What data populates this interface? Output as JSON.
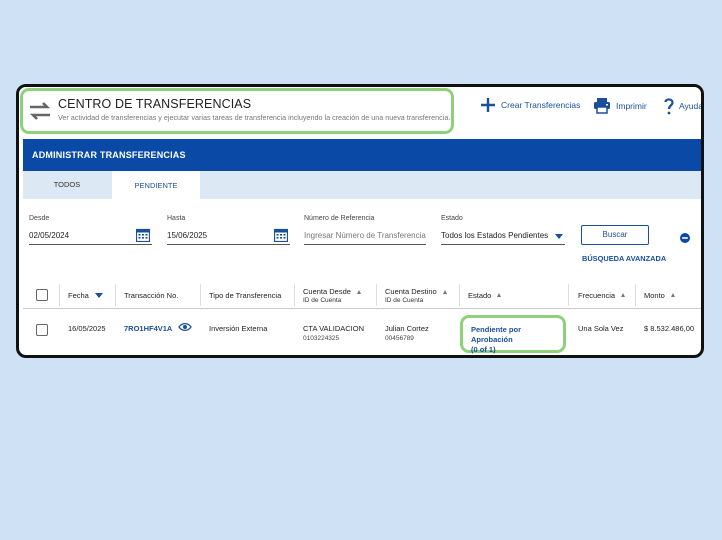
{
  "header": {
    "title": "CENTRO DE TRANSFERENCIAS",
    "subtitle": "Ver actividad de transferencias y ejecutar varias tareas de transferencia incluyendo la creación de una nueva transferencia.",
    "actions": {
      "create": "Crear Transferencias",
      "print": "Imprimir",
      "help": "Ayuda"
    }
  },
  "section": {
    "title": "ADMINISTRAR TRANSFERENCIAS"
  },
  "tabs": [
    {
      "label": "TODOS",
      "active": false
    },
    {
      "label": "PENDIENTE",
      "active": true
    }
  ],
  "filters": {
    "desde": {
      "label": "Desde",
      "value": "02/05/2024"
    },
    "hasta": {
      "label": "Hasta",
      "value": "15/06/2025"
    },
    "referencia": {
      "label": "Número de Referencia",
      "placeholder": "Ingresar Número de Transferencia"
    },
    "estado": {
      "label": "Estado",
      "value": "Todos los Estados Pendientes"
    },
    "search_button": "Buscar",
    "advanced_search": "BÚSQUEDA AVANZADA"
  },
  "table": {
    "columns": {
      "fecha": "Fecha",
      "transaccion": "Transacción No.",
      "tipo": "Tipo de Transferencia",
      "cuenta_desde": "Cuenta Desde",
      "cuenta_desde_sub": "ID de Cuenta",
      "cuenta_destino": "Cuenta Destino",
      "cuenta_destino_sub": "ID de Cuenta",
      "estado": "Estado",
      "frecuencia": "Frecuencia",
      "monto": "Monto"
    },
    "rows": [
      {
        "fecha": "16/05/2025",
        "transaccion": "7RO1HF4V1A",
        "tipo": "Inversión Externa",
        "cuenta_desde": "CTA VALIDACION",
        "cuenta_desde_id": "0103224325",
        "cuenta_destino": "Julian Cortez",
        "cuenta_destino_id": "00456789",
        "estado": "Pendiente por Aprobación",
        "estado_sub": "(0 of 1)",
        "frecuencia": "Una Sola Vez",
        "monto": "$ 8.532.486,00"
      }
    ]
  },
  "colors": {
    "brand_blue": "#0a4aa6",
    "link_blue": "#1a4f9c",
    "highlight_green": "#8fd07a",
    "background": "#cfe1f4"
  },
  "icons": [
    "swap-arrows-icon",
    "plus-icon",
    "printer-icon",
    "question-icon",
    "calendar-icon",
    "chevron-down-icon",
    "minus-circle-icon",
    "eye-icon"
  ]
}
